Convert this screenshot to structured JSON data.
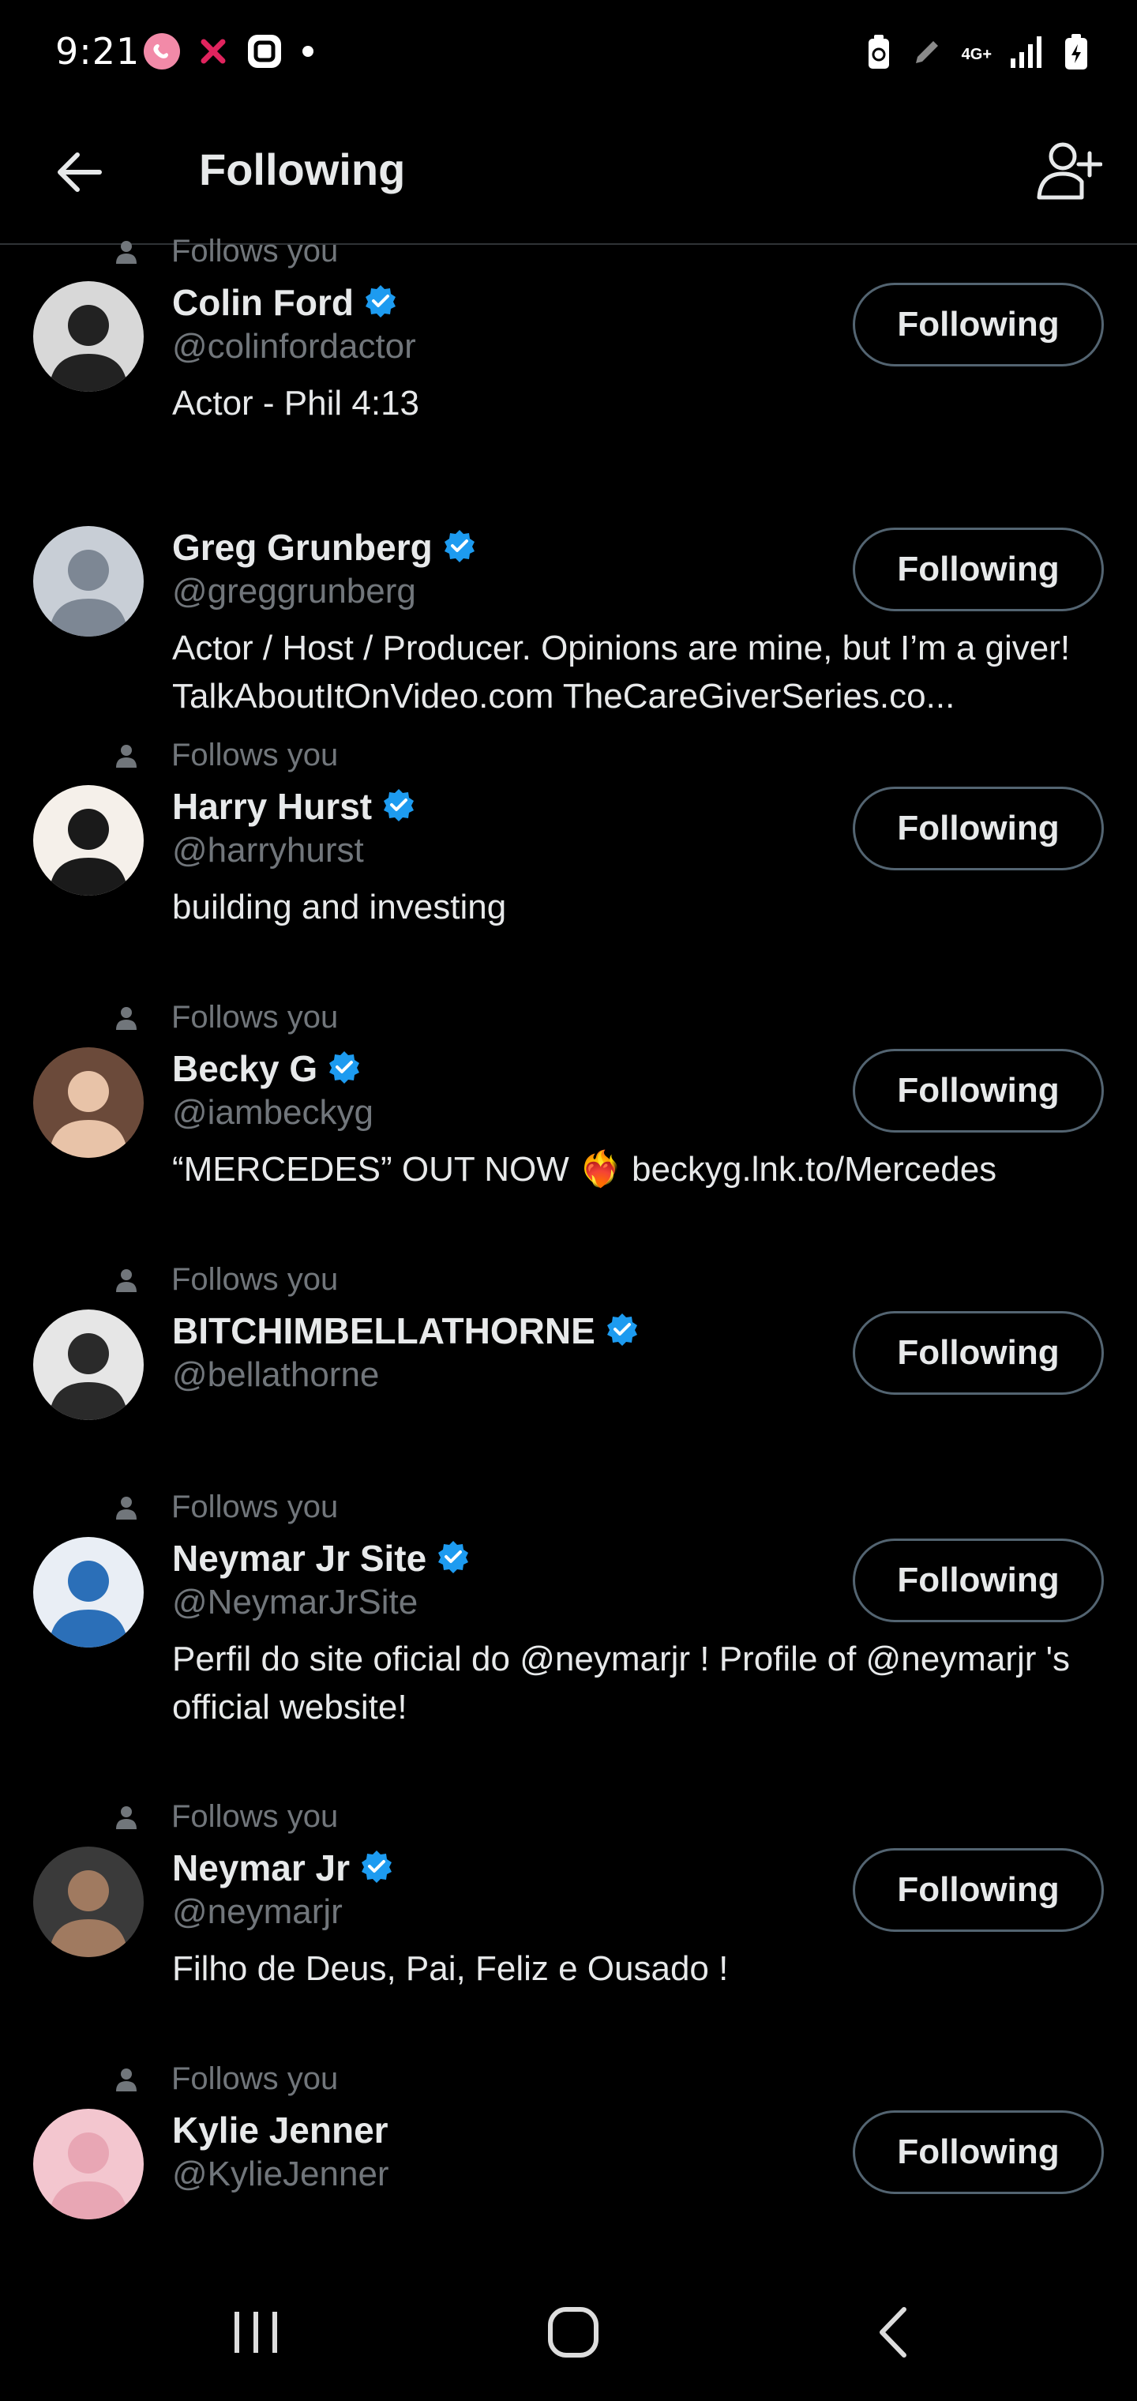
{
  "status_bar": {
    "time": "9:21",
    "network": "4G+"
  },
  "header": {
    "title": "Following"
  },
  "accounts": [
    {
      "follows_you": "Follows you",
      "name": "Colin Ford",
      "verified": true,
      "handle": "@colinfordactor",
      "bio": "Actor - Phil 4:13",
      "button": "Following"
    },
    {
      "follows_you": "",
      "name": "Greg Grunberg",
      "verified": true,
      "handle": "@greggrunberg",
      "bio": "Actor / Host / Producer. Opinions are mine, but I’m a giver! TalkAboutItOnVideo.com TheCareGiverSeries.co...",
      "button": "Following"
    },
    {
      "follows_you": "Follows you",
      "name": "Harry Hurst",
      "verified": true,
      "handle": "@harryhurst",
      "bio": "building and investing",
      "button": "Following"
    },
    {
      "follows_you": "Follows you",
      "name": "Becky G",
      "verified": true,
      "handle": "@iambeckyg",
      "bio": "“MERCEDES” OUT NOW ❤️‍🔥 beckyg.lnk.to/Mercedes",
      "button": "Following"
    },
    {
      "follows_you": "Follows you",
      "name": "BITCHIMBELLATHORNE",
      "verified": true,
      "handle": "@bellathorne",
      "bio": "",
      "button": "Following"
    },
    {
      "follows_you": "Follows you",
      "name": "Neymar Jr Site",
      "verified": true,
      "handle": "@NeymarJrSite",
      "bio": "Perfil do site oficial do @neymarjr ! Profile of @neymarjr 's official website!",
      "button": "Following"
    },
    {
      "follows_you": "Follows you",
      "name": "Neymar Jr",
      "verified": true,
      "handle": "@neymarjr",
      "bio": "Filho de Deus, Pai, Feliz e Ousado !",
      "button": "Following"
    },
    {
      "follows_you": "Follows you",
      "name": "Kylie Jenner",
      "verified": false,
      "handle": "@KylieJenner",
      "bio": "",
      "button": "Following"
    }
  ],
  "colors": {
    "background": "#000000",
    "text_primary": "#e7e9ea",
    "text_secondary": "#71767b",
    "verified_badge": "#1d9bf0",
    "button_border": "#536471"
  },
  "icons": {
    "back": "arrow-left-icon",
    "add_user": "person-add-icon",
    "verified": "verified-badge-icon",
    "follows_you": "person-icon"
  }
}
